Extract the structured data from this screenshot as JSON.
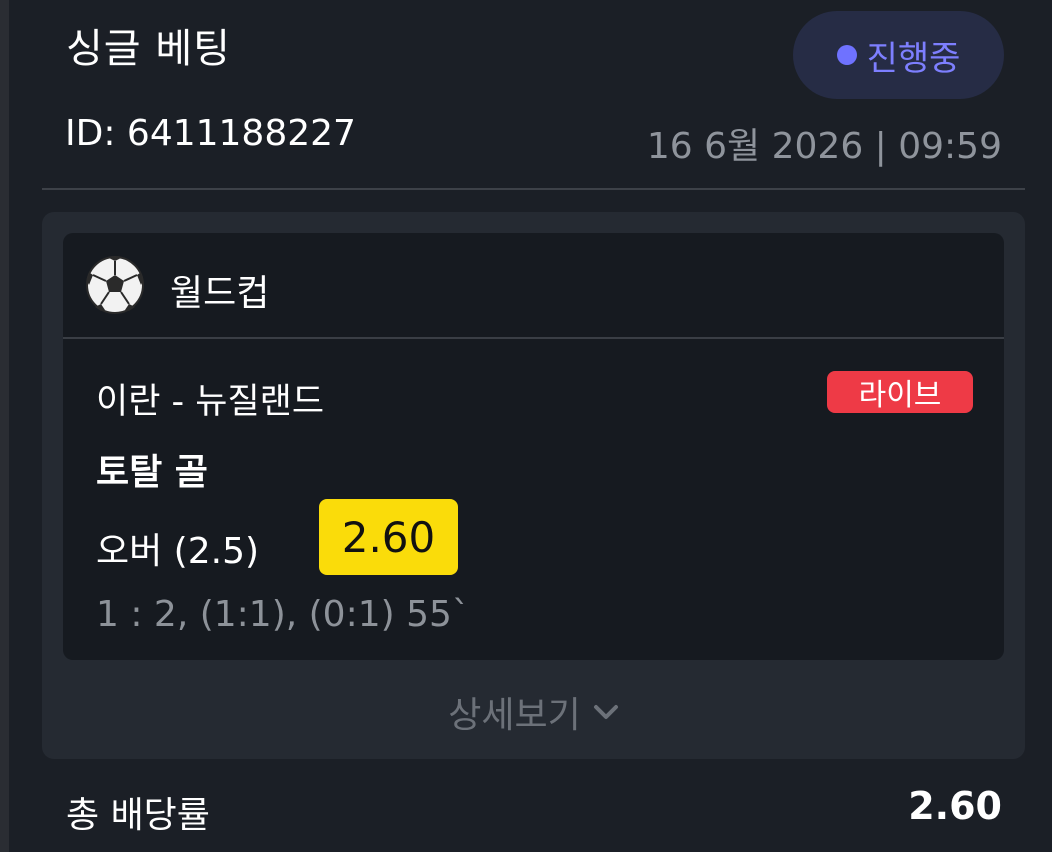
{
  "header": {
    "title": "싱글 베팅",
    "status_label": "진행중",
    "bet_id": "ID: 6411188227",
    "datetime": "16 6월 2026 | 09:59"
  },
  "bet": {
    "league": "월드컵",
    "sport_icon": "soccer-ball-icon",
    "match": "이란 - 뉴질랜드",
    "live_label": "라이브",
    "market": "토탈 골",
    "selection": "오버 (2.5)",
    "odds": "2.60",
    "score": "1 : 2, (1:1), (0:1) 55`"
  },
  "details": {
    "label": "상세보기",
    "icon": "chevron-down-icon"
  },
  "summary": {
    "total_odds_label": "총 배당률",
    "total_odds_value": "2.60"
  },
  "colors": {
    "background": "#1b1f26",
    "status": "#7d7fff",
    "live": "#ee3a46",
    "odds_highlight": "#fadc0a"
  }
}
